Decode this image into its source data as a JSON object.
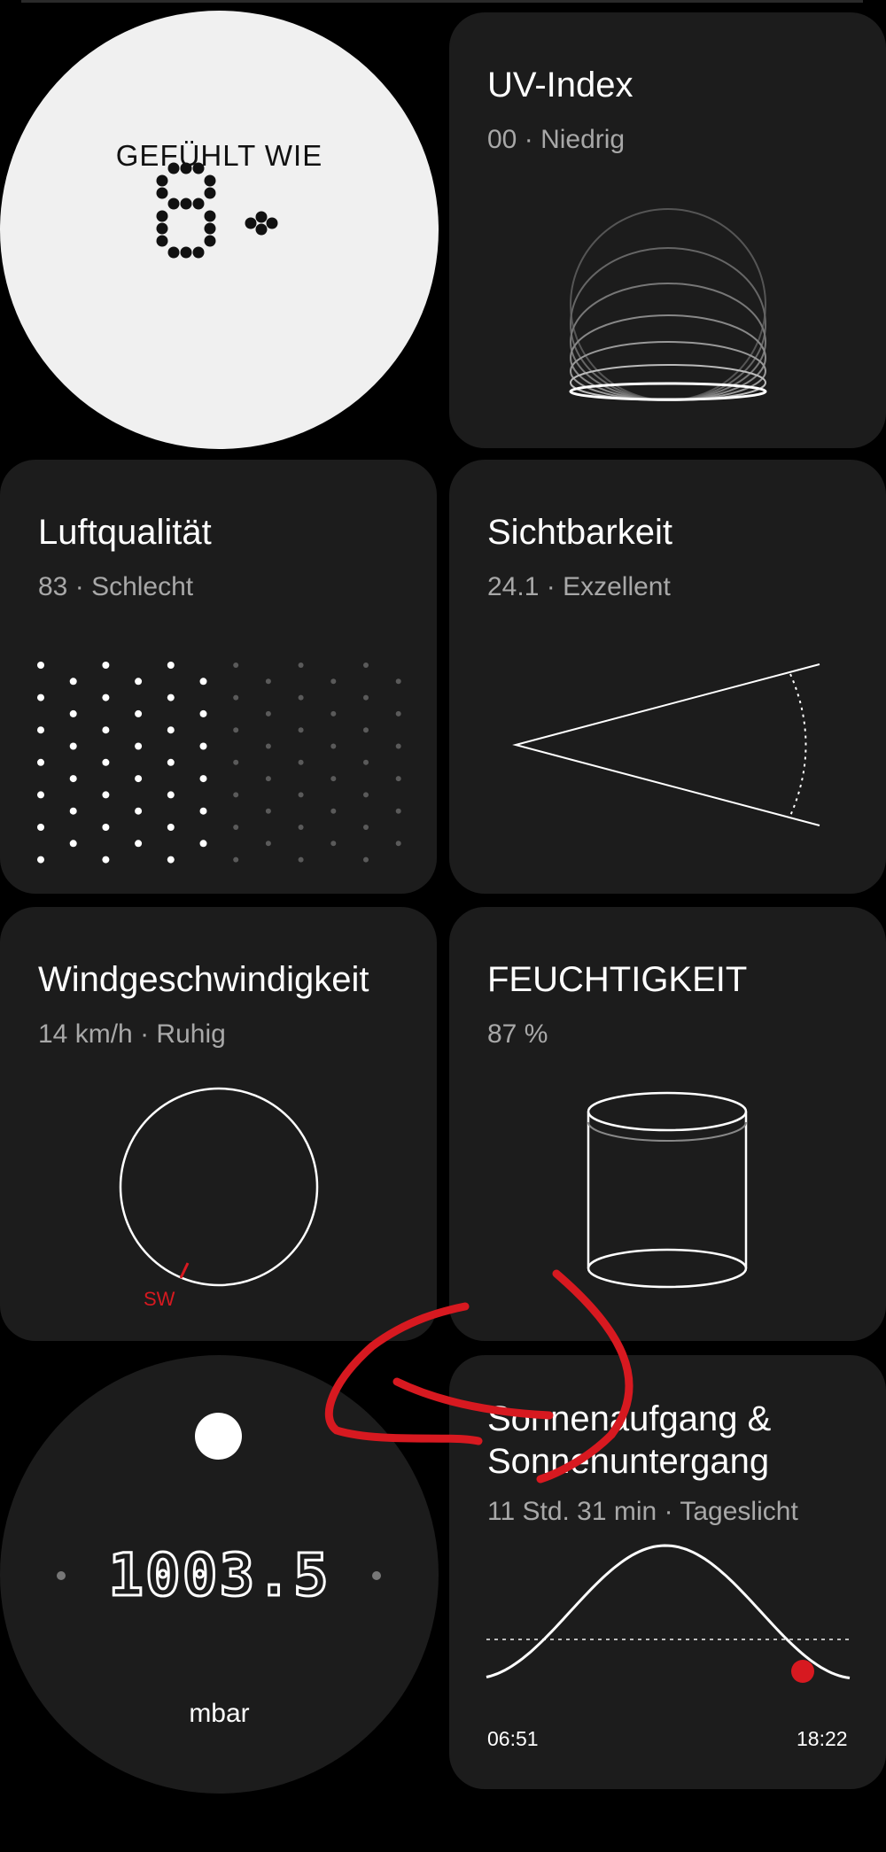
{
  "feels_like": {
    "label": "GEFÜHLT WIE",
    "value": "8",
    "unit": "°"
  },
  "uv": {
    "title": "UV-Index",
    "value": "00",
    "level": "Niedrig"
  },
  "air": {
    "title": "Luftqualität",
    "value": "83",
    "level": "Schlecht"
  },
  "visibility": {
    "title": "Sichtbarkeit",
    "value": "24.1",
    "level": "Exzellent"
  },
  "wind": {
    "title": "Windgeschwindigkeit",
    "value": "14 km/h",
    "level": "Ruhig",
    "direction": "SW"
  },
  "humidity": {
    "title": "FEUCHTIGKEIT",
    "value": "87 %"
  },
  "pressure": {
    "value": "1003.5",
    "unit": "mbar"
  },
  "sun": {
    "title_line1": "Sonnenaufgang &",
    "title_line2": "Sonnenuntergang",
    "daylight": "11 Std. 31 min",
    "daylight_label": "Tageslicht",
    "sunrise": "06:51",
    "sunset": "18:22"
  },
  "separator": "·",
  "colors": {
    "background": "#000000",
    "card": "#1c1c1c",
    "accent": "#d71920",
    "feels_like_bg": "#f0f0f0"
  }
}
